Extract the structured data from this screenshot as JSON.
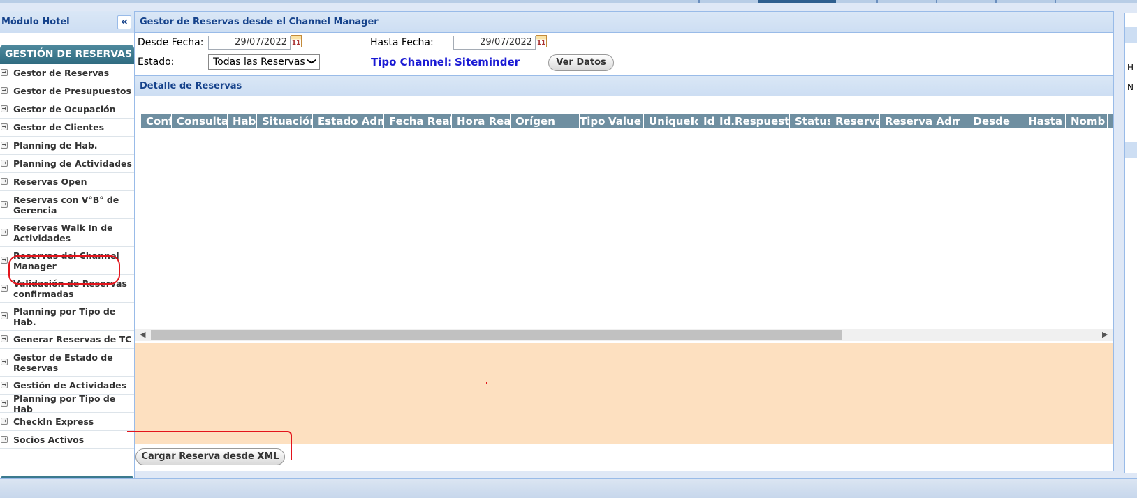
{
  "sidebar": {
    "title": "Módulo Hotel",
    "collapse_icon": "«",
    "section": "GESTIÓN DE RESERVAS",
    "items": [
      {
        "label": "Gestor de Reservas"
      },
      {
        "label": "Gestor de Presupuestos"
      },
      {
        "label": "Gestor de Ocupación"
      },
      {
        "label": "Gestor de Clientes"
      },
      {
        "label": "Planning de Hab."
      },
      {
        "label": "Planning de Actividades"
      },
      {
        "label": "Reservas Open"
      },
      {
        "label": "Reservas con V°B° de Gerencia"
      },
      {
        "label": "Reservas Walk In de Actividades"
      },
      {
        "label": "Reservas del Channel Manager"
      },
      {
        "label": "Validación de Reservas confirmadas"
      },
      {
        "label": "Planning por Tipo de Hab."
      },
      {
        "label": "Generar Reservas de TC"
      },
      {
        "label": "Gestor de Estado de Reservas"
      },
      {
        "label": "Gestión de Actividades"
      },
      {
        "label": "Planning por Tipo de Hab"
      },
      {
        "label": "CheckIn Express"
      },
      {
        "label": "Socios Activos"
      }
    ]
  },
  "main": {
    "title": "Gestor de Reservas desde el Channel Manager",
    "filters": {
      "desde_label": "Desde Fecha:",
      "desde_value": "29/07/2022",
      "hasta_label": "Hasta Fecha:",
      "hasta_value": "29/07/2022",
      "estado_label": "Estado:",
      "estado_value": "Todas las Reservas",
      "channel_label": "Tipo Channel:",
      "channel_value": "Siteminder",
      "ver_datos": "Ver Datos",
      "calendar_icon_text": "11"
    },
    "detail_title": "Detalle de Reservas",
    "columns": [
      "Conf",
      "Consulta",
      "Hab.",
      "Situación",
      "Estado Adm",
      "Fecha Real.",
      "Hora Real",
      "Orígen",
      "Tipo",
      "Value",
      "UniqueId",
      "Id",
      "Id.Respuesta",
      "Status",
      "Reserva",
      "Reserva Adm.",
      "Desde",
      "Hasta",
      "Nomb"
    ],
    "load_button": "Cargar Reserva desde XML"
  },
  "right_strip": {
    "letters": [
      "H",
      "N"
    ]
  },
  "colors": {
    "header_blue": "#15428b",
    "section_teal": "#2f6b80",
    "grid_header": "#6f8fa1",
    "orange_panel": "#fde0c0",
    "annotation_red": "#e3141c",
    "channel_blue": "#1a1ad4"
  }
}
